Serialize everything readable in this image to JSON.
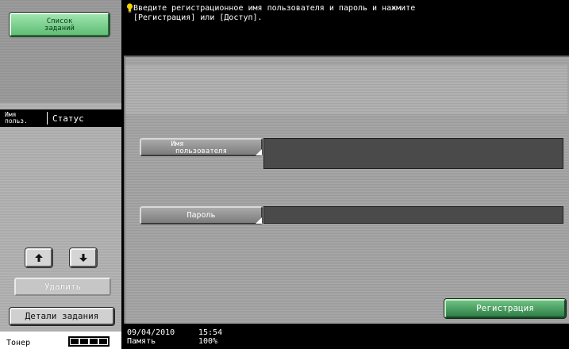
{
  "sidebar": {
    "job_list_button": {
      "line1": "Список",
      "line2": "заданий"
    },
    "columns": {
      "user_line1": "Имя",
      "user_line2": "польз.",
      "status": "Статус"
    },
    "delete_label": "Удалить",
    "job_details_label": "Детали задания",
    "toner_label": "Тонер",
    "toner_level_segments": 4
  },
  "message": {
    "line1": "Введите регистрационное имя пользователя и пароль и нажмите",
    "line2": "[Регистрация] или [Доступ]."
  },
  "form": {
    "username_label_line1": "Имя",
    "username_label_line2": "пользователя",
    "username_value": "",
    "password_label": "Пароль",
    "password_value": "",
    "register_label": "Регистрация"
  },
  "status_bar": {
    "date": "09/04/2010",
    "time": "15:54",
    "memory_label": "Память",
    "memory_value": "100%"
  },
  "colors": {
    "accent_green": "#5fbd75",
    "message_bg": "#000000",
    "field_bg": "#4a4a4a"
  },
  "icons": {
    "hint": "lightbulb-icon",
    "up": "arrow-up-icon",
    "down": "arrow-down-icon"
  }
}
